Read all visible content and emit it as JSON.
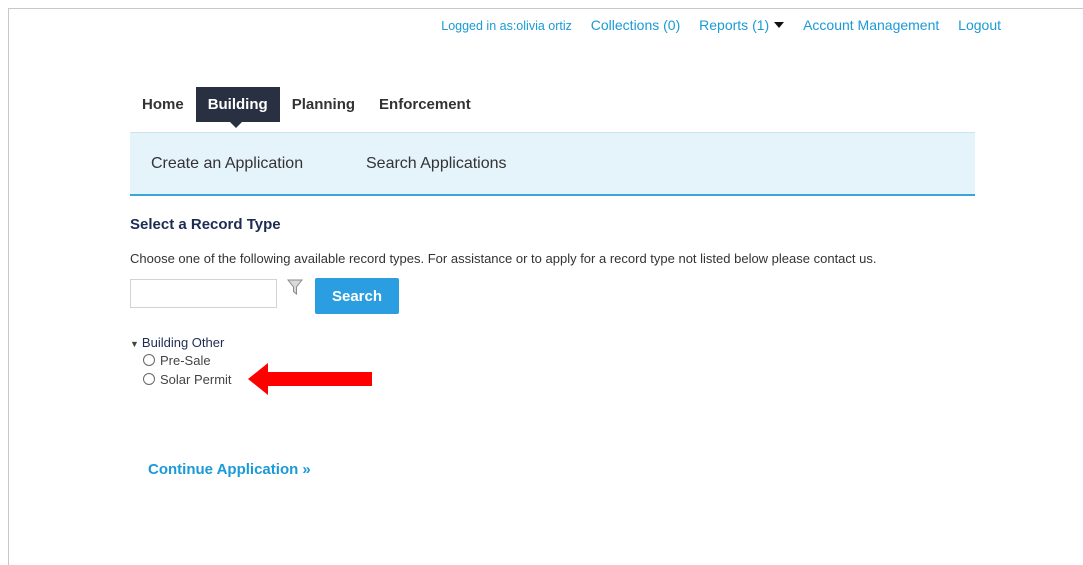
{
  "header": {
    "logged_in_text": "Logged in as:olivia ortiz",
    "collections": "Collections (0)",
    "reports": "Reports (1)",
    "account": "Account Management",
    "logout": "Logout"
  },
  "tabs": [
    {
      "label": "Home",
      "active": false
    },
    {
      "label": "Building",
      "active": true
    },
    {
      "label": "Planning",
      "active": false
    },
    {
      "label": "Enforcement",
      "active": false
    }
  ],
  "subnav": {
    "create": "Create an Application",
    "search": "Search Applications"
  },
  "main": {
    "title": "Select a Record Type",
    "instructions": "Choose one of the following available record types. For assistance or to apply for a record type not listed below please contact us.",
    "search_value": "",
    "search_button": "Search",
    "group": {
      "label": "Building Other",
      "options": [
        "Pre-Sale",
        "Solar Permit"
      ]
    },
    "continue": "Continue Application »"
  },
  "colors": {
    "link": "#1a9ad6",
    "active_tab": "#283041",
    "subnav_bg": "#e5f3fb",
    "button": "#2a9ee0",
    "annotation_arrow": "#ff0000"
  },
  "icons": {
    "filter": "filter-funnel-icon",
    "reports_dropdown": "caret-down-icon",
    "group_toggle": "triangle-down-icon",
    "annotation": "red-arrow-left"
  }
}
